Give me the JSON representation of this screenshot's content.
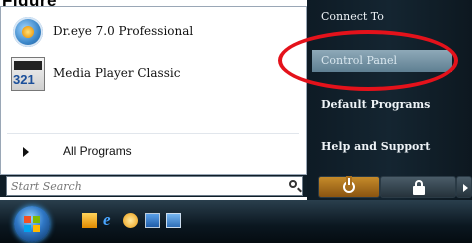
{
  "heading": "Figure",
  "programs": [
    {
      "label": "Dr.eye 7.0 Professional",
      "icon": "dreye-icon"
    },
    {
      "label": "Media Player Classic",
      "icon": "media-player-icon",
      "badge": "321"
    }
  ],
  "all_programs": "All Programs",
  "right_menu": {
    "connect_to": "Connect To",
    "control_panel": "Control Panel",
    "default_programs": "Default Programs",
    "help_support": "Help and Support"
  },
  "search": {
    "placeholder": "Start Search",
    "icon": "search-icon"
  },
  "buttons": {
    "power": "power-icon",
    "lock": "lock-icon",
    "more": "arrow-right-icon"
  },
  "taskbar": {
    "start": "windows-start-orb",
    "quick_launch": [
      "media-icon",
      "internet-explorer-icon",
      "folder-icon",
      "show-desktop-icon",
      "switch-windows-icon"
    ],
    "ie_glyph": "e"
  },
  "colors": {
    "highlight": "#e4121b",
    "menu_dark": "#142531",
    "selection": "#7896a7"
  }
}
